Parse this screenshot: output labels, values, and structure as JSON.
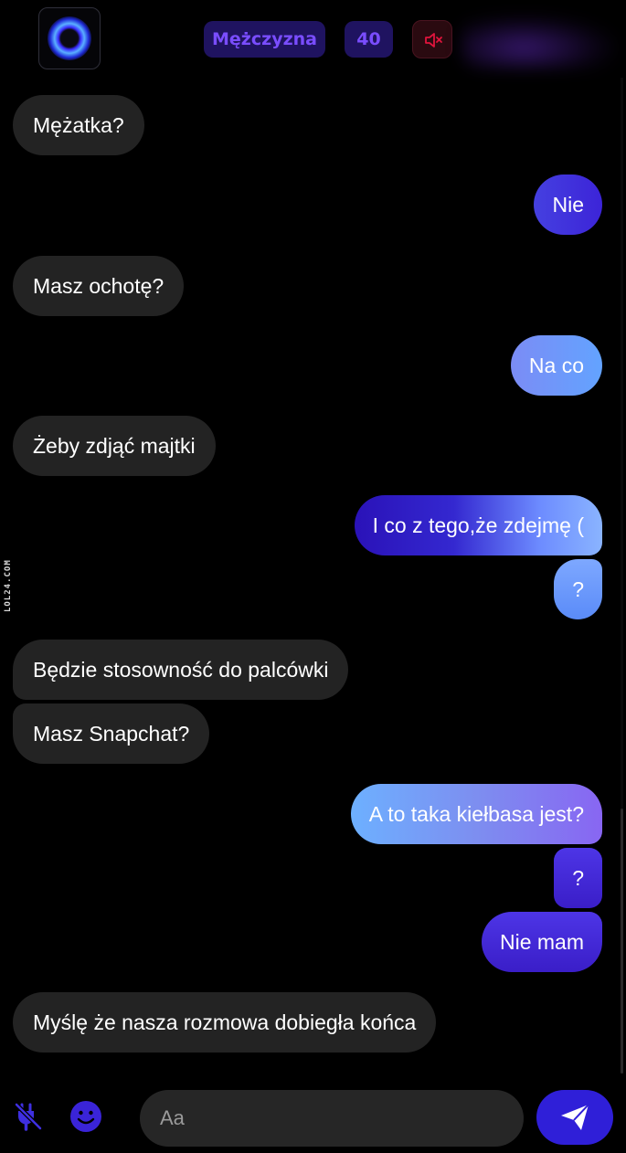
{
  "header": {
    "gender_label": "Mężczyzna",
    "age_label": "40",
    "logo_icon": "orb-logo-icon",
    "mute_icon": "speaker-muted-icon"
  },
  "messages": [
    {
      "side": "in",
      "text": "Mężatka?"
    },
    {
      "side": "out",
      "text": "Nie"
    },
    {
      "side": "in",
      "text": "Masz ochotę?"
    },
    {
      "side": "out",
      "text": "Na co"
    },
    {
      "side": "in",
      "text": "Żeby zdjąć majtki"
    },
    {
      "side": "out",
      "text": "I co z tego,że zdejmę ("
    },
    {
      "side": "out",
      "text": "?"
    },
    {
      "side": "in",
      "text": "Będzie stosowność do palcówki"
    },
    {
      "side": "in",
      "text": "Masz Snapchat?"
    },
    {
      "side": "out",
      "text": "A to taka kiełbasa jest?"
    },
    {
      "side": "out",
      "text": "?"
    },
    {
      "side": "out",
      "text": "Nie mam"
    },
    {
      "side": "in",
      "text": "Myślę że nasza rozmowa dobiegła końca"
    }
  ],
  "watermark": "LOL24.COM",
  "composer": {
    "placeholder": "Aa",
    "plug_icon": "disconnect-plug-icon",
    "emoji_icon": "emoji-icon",
    "send_icon": "send-icon"
  },
  "colors": {
    "accent": "#2f1fd8",
    "pill_bg": "#1f1360",
    "pill_text": "#7a4dff",
    "incoming_bubble": "#232323",
    "mute_red": "#e0143c"
  }
}
